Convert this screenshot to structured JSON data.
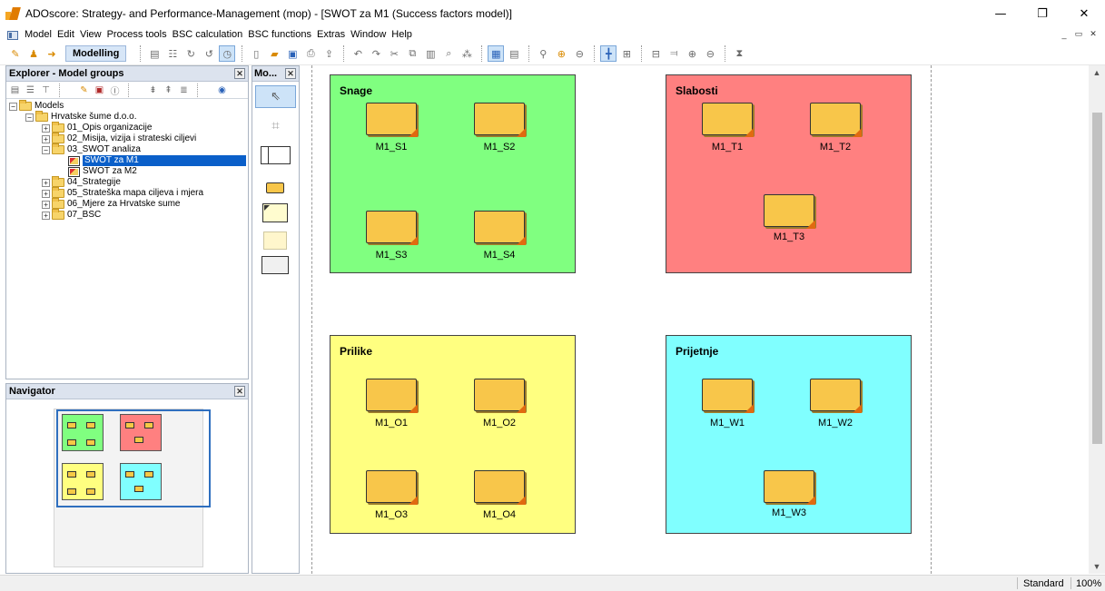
{
  "window": {
    "title": "ADOscore: Strategy- and Performance-Management (mop) - [SWOT za M1 (Success factors model)]",
    "controls": [
      "—",
      "❐",
      "✕"
    ],
    "mdi_controls": [
      "_",
      "▭",
      "✕"
    ]
  },
  "menubar": {
    "items": [
      "Model",
      "Edit",
      "View",
      "Process tools",
      "BSC calculation",
      "BSC functions",
      "Extras",
      "Window",
      "Help"
    ]
  },
  "toolbar": {
    "mode_label": "Modelling"
  },
  "explorer": {
    "title": "Explorer - Model groups",
    "close": "✕",
    "tree": [
      {
        "label": "Models",
        "expander": "−",
        "type": "folder",
        "indent": 0
      },
      {
        "label": "Hrvatske šume d.o.o.",
        "expander": "−",
        "type": "folder",
        "indent": 1
      },
      {
        "label": "01_Opis organizacije",
        "expander": "+",
        "type": "folder",
        "indent": 2
      },
      {
        "label": "02_Misija, vizija i strateski ciljevi",
        "expander": "+",
        "type": "folder",
        "indent": 2
      },
      {
        "label": "03_SWOT analiza",
        "expander": "−",
        "type": "folder",
        "indent": 2
      },
      {
        "label": "SWOT za M1",
        "expander": "",
        "type": "model",
        "indent": 3,
        "selected": true
      },
      {
        "label": "SWOT za M2",
        "expander": "",
        "type": "model",
        "indent": 3
      },
      {
        "label": "04_Strategije",
        "expander": "+",
        "type": "folder",
        "indent": 2
      },
      {
        "label": "05_Strateška mapa ciljeva i mjera",
        "expander": "+",
        "type": "folder",
        "indent": 2
      },
      {
        "label": "06_Mjere za Hrvatske sume",
        "expander": "+",
        "type": "folder",
        "indent": 2
      },
      {
        "label": "07_BSC",
        "expander": "+",
        "type": "folder",
        "indent": 2
      }
    ]
  },
  "palette": {
    "title": "Mo...",
    "close": "✕"
  },
  "navigator": {
    "title": "Navigator",
    "close": "✕"
  },
  "model": {
    "quadrants": [
      {
        "title": "Snage",
        "color": "#80ff80",
        "notes": [
          "M1_S1",
          "M1_S2",
          "M1_S3",
          "M1_S4"
        ]
      },
      {
        "title": "Slabosti",
        "color": "#ff8080",
        "notes": [
          "M1_T1",
          "M1_T2",
          "M1_T3"
        ]
      },
      {
        "title": "Prilike",
        "color": "#ffff80",
        "notes": [
          "M1_O1",
          "M1_O2",
          "M1_O3",
          "M1_O4"
        ]
      },
      {
        "title": "Prijetnje",
        "color": "#80ffff",
        "notes": [
          "M1_W1",
          "M1_W2",
          "M1_W3"
        ]
      }
    ],
    "note_color": "#f8c64a"
  },
  "statusbar": {
    "mode": "Standard",
    "zoom": "100%"
  }
}
